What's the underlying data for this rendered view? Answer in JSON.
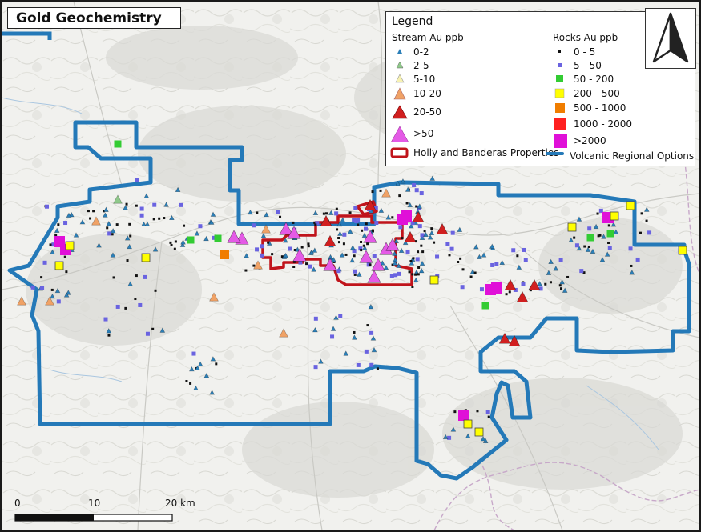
{
  "title": "Gold Geochemistry",
  "legend": {
    "heading": "Legend",
    "stream_heading": "Stream Au ppb",
    "rocks_heading": "Rocks Au ppb",
    "stream_classes": [
      {
        "label": "0-2",
        "color": "#2b7fb8"
      },
      {
        "label": "2-5",
        "color": "#8fc98a"
      },
      {
        "label": "5-10",
        "color": "#f7f2b2"
      },
      {
        "label": "10-20",
        "color": "#f0a266"
      },
      {
        "label": "20-50",
        "color": "#d11f1f"
      },
      {
        "label": ">50",
        "color": "#e45ae6"
      }
    ],
    "rock_classes": [
      {
        "label": "0 - 5",
        "color": "#111111"
      },
      {
        "label": "5 - 50",
        "color": "#6a63e0"
      },
      {
        "label": "50 - 200",
        "color": "#33cc33"
      },
      {
        "label": "200 - 500",
        "color": "#ffff00"
      },
      {
        "label": "500 - 1000",
        "color": "#f07d00"
      },
      {
        "label": "1000 - 2000",
        "color": "#ff2020"
      },
      {
        "label": ">2000",
        "color": "#e010d8"
      }
    ],
    "property_label": "Holly and Banderas Properties",
    "property_color": "#c0141b",
    "regional_label": "Volcanic Regional Options",
    "regional_color": "#2479b8"
  },
  "scale_bar": {
    "ticks": [
      "0",
      "10",
      "20 km"
    ]
  },
  "north_arrow": "north-arrow-icon"
}
